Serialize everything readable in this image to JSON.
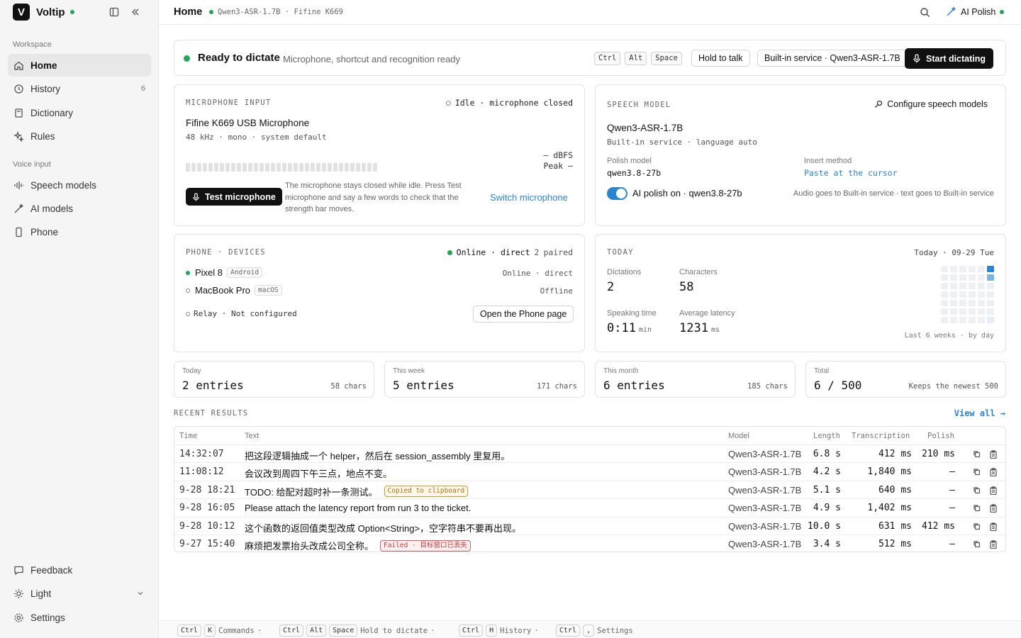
{
  "app": {
    "name": "Voltip"
  },
  "sidebar": {
    "sections": {
      "workspace": "Workspace",
      "voice": "Voice input"
    },
    "items": [
      {
        "label": "Home"
      },
      {
        "label": "History",
        "count": "6"
      },
      {
        "label": "Dictionary"
      },
      {
        "label": "Rules"
      },
      {
        "label": "Speech models"
      },
      {
        "label": "AI models"
      },
      {
        "label": "Phone"
      }
    ],
    "bottom": {
      "feedback": "Feedback",
      "theme": "Light",
      "settings": "Settings"
    }
  },
  "topbar": {
    "title": "Home",
    "status": "Qwen3-ASR-1.7B · Fifine K669",
    "polish": "AI Polish"
  },
  "ready": {
    "title": "Ready to dictate",
    "subtitle": "Microphone, shortcut and recognition ready",
    "keys": [
      "Ctrl",
      "Alt",
      "Space"
    ],
    "hold": "Hold to talk",
    "service": "Built-in service · Qwen3-ASR-1.7B",
    "start": "Start dictating"
  },
  "mic": {
    "label": "MICROPHONE INPUT",
    "state": "Idle · microphone closed",
    "name": "Fifine K669 USB Microphone",
    "spec": "48 kHz · mono · system default",
    "dbfs": "— dBFS",
    "peak": "Peak —",
    "level": 0,
    "test": "Test microphone",
    "help": "The microphone stays closed while idle. Press Test microphone and say a few words to check that the strength bar moves.",
    "switch": "Switch microphone"
  },
  "speech": {
    "label": "SPEECH MODEL",
    "configure": "Configure speech models",
    "model": "Qwen3-ASR-1.7B",
    "model_sub": "Built-in service · language auto",
    "polish_label": "Polish model",
    "polish_value": "qwen3.8-27b",
    "insert_label": "Insert method",
    "insert_value": "Paste at the cursor",
    "ai_polish": "AI polish on · qwen3.8-27b",
    "ai_polish_on": true,
    "route": "Audio goes to Built-in service · text goes to Built-in service"
  },
  "phone": {
    "label": "PHONE · DEVICES",
    "status": "Online · direct",
    "paired_num": "2",
    "paired_word": "paired",
    "devices": [
      {
        "name": "Pixel 8",
        "os": "Android",
        "state": "Online · direct"
      },
      {
        "name": "MacBook Pro",
        "os": "macOS",
        "state": "Offline"
      }
    ],
    "relay": "Relay · Not configured",
    "open": "Open the Phone page"
  },
  "today": {
    "label": "TODAY",
    "date": "Today · 09-29 Tue",
    "dictations_label": "Dictations",
    "dictations": "2",
    "chars_label": "Characters",
    "chars": "58",
    "speaking_label": "Speaking time",
    "speaking": "0:11",
    "speaking_unit": "min",
    "latency_label": "Average latency",
    "latency": "1231",
    "latency_unit": "ms",
    "heat_caption": "Last 6 weeks · by day"
  },
  "stats": [
    {
      "label": "Today",
      "value": "2 entries",
      "sub": "58 chars"
    },
    {
      "label": "This week",
      "value": "5 entries",
      "sub": "171 chars"
    },
    {
      "label": "This month",
      "value": "6 entries",
      "sub": "185 chars"
    },
    {
      "label": "Total",
      "value": "6 / 500",
      "sub": "Keeps the newest 500"
    }
  ],
  "recent": {
    "label": "RECENT RESULTS",
    "view_all": "View all →",
    "headers": {
      "time": "Time",
      "text": "Text",
      "model": "Model",
      "length": "Length",
      "transcription": "Transcription",
      "polish": "Polish"
    },
    "rows": [
      {
        "time": "14:32:07",
        "text": "把这段逻辑抽成一个 helper，然后在 session_assembly 里复用。",
        "tag": "",
        "model": "Qwen3-ASR-1.7B",
        "length": "6.8 s",
        "transcription": "412 ms",
        "polish": "210 ms"
      },
      {
        "time": "11:08:12",
        "text": "会议改到周四下午三点，地点不变。",
        "tag": "",
        "model": "Qwen3-ASR-1.7B",
        "length": "4.2 s",
        "transcription": "1,840 ms",
        "polish": "—"
      },
      {
        "time": "9-28 18:21",
        "text": "TODO: 给配对超时补一条测试。",
        "tag": "Copied to clipboard",
        "model": "Qwen3-ASR-1.7B",
        "length": "5.1 s",
        "transcription": "640 ms",
        "polish": "—"
      },
      {
        "time": "9-28 16:05",
        "text": "Please attach the latency report from run 3 to the ticket.",
        "tag": "",
        "model": "Qwen3-ASR-1.7B",
        "length": "4.9 s",
        "transcription": "1,402 ms",
        "polish": "—"
      },
      {
        "time": "9-28 10:12",
        "text": "这个函数的返回值类型改成 Option<String>，空字符串不要再出现。",
        "tag": "",
        "model": "Qwen3-ASR-1.7B",
        "length": "10.0 s",
        "transcription": "631 ms",
        "polish": "412 ms"
      },
      {
        "time": "9-27 15:40",
        "text": "麻烦把发票抬头改成公司全称。",
        "tag": "Failed · 目标窗口已丢失",
        "model": "Qwen3-ASR-1.7B",
        "length": "3.4 s",
        "transcription": "512 ms",
        "polish": "—"
      }
    ]
  },
  "footer": [
    {
      "keys": [
        "Ctrl",
        "K"
      ],
      "label": "Commands"
    },
    {
      "keys": [
        "Ctrl",
        "Alt",
        "Space"
      ],
      "label": "Hold to dictate"
    },
    {
      "keys": [
        "Ctrl",
        "H"
      ],
      "label": "History"
    },
    {
      "keys": [
        "Ctrl",
        ","
      ],
      "label": "Settings"
    }
  ],
  "colors": {
    "accent": "#2a84d2",
    "online": "#22a557",
    "dark": "#111111"
  }
}
